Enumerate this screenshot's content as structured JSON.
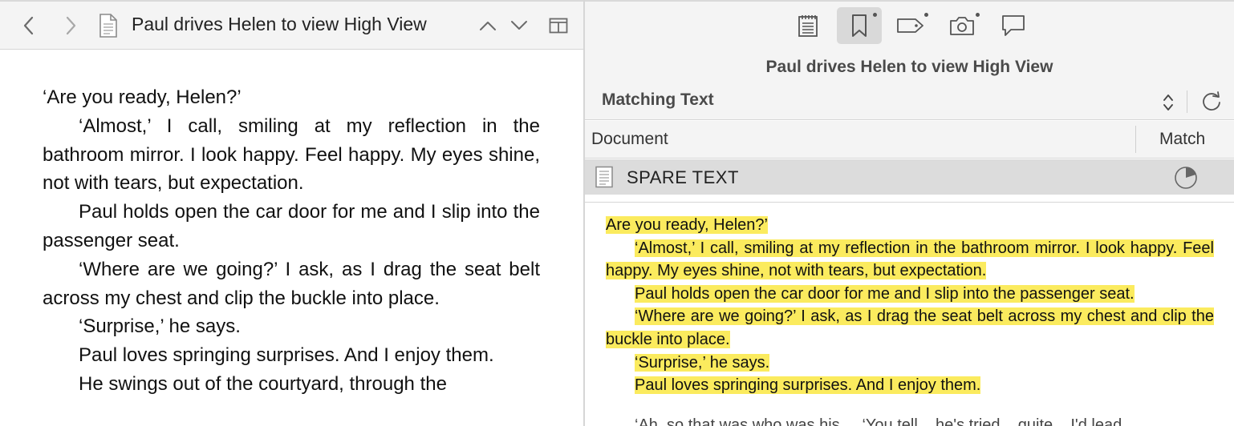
{
  "editor": {
    "back_icon": "chevron-left-icon",
    "forward_icon": "chevron-right-icon",
    "document_icon": "document-icon",
    "title": "Paul drives Helen to view High View",
    "paragraphs": [
      "‘Are you ready, Helen?’",
      "‘Almost,’ I call, smiling at my reflection in the bathroom mirror. I look happy. Feel happy. My eyes shine, not with tears, but expectation.",
      "Paul holds open the car door for me and I slip into the passenger seat.",
      "‘Where are we going?’ I ask, as I drag the seat belt across my chest and clip the buckle into place.",
      "‘Surprise,’ he says.",
      "Paul loves springing surprises. And I enjoy them.",
      "He swings out of the courtyard, through the"
    ]
  },
  "inspector": {
    "toolbar": [
      {
        "name": "notes-icon"
      },
      {
        "name": "bookmark-icon",
        "active": true
      },
      {
        "name": "tag-icon"
      },
      {
        "name": "snapshot-camera-icon"
      },
      {
        "name": "comment-icon"
      }
    ],
    "title": "Paul drives Helen to view High View",
    "selector_label": "Matching Text",
    "columns": {
      "document": "Document",
      "match": "Match"
    },
    "result": {
      "label": "SPARE TEXT",
      "match_fraction": 0.2
    },
    "preview": [
      "Are you ready, Helen?’",
      "‘Almost,’ I call, smiling at my reflection in the bathroom mirror. I look happy. Feel happy. My eyes shine, not with tears, but expectation.",
      "Paul holds open the car door for me and I slip into the passenger seat.",
      "‘Where are we going?’ I ask, as I drag the seat belt across my chest and clip the buckle into place.",
      "‘Surprise,’ he says.",
      "Paul loves springing surprises. And I enjoy them."
    ],
    "preview_partial": "‘Ah, so that was who was his ... ‘You tell... he's tried... quite... I'd lead"
  },
  "colors": {
    "highlight": "#fbeb5e",
    "active_tool": "#d9d9d9",
    "header_bg": "#f4f4f4",
    "row_bg": "#dcdcdc"
  }
}
